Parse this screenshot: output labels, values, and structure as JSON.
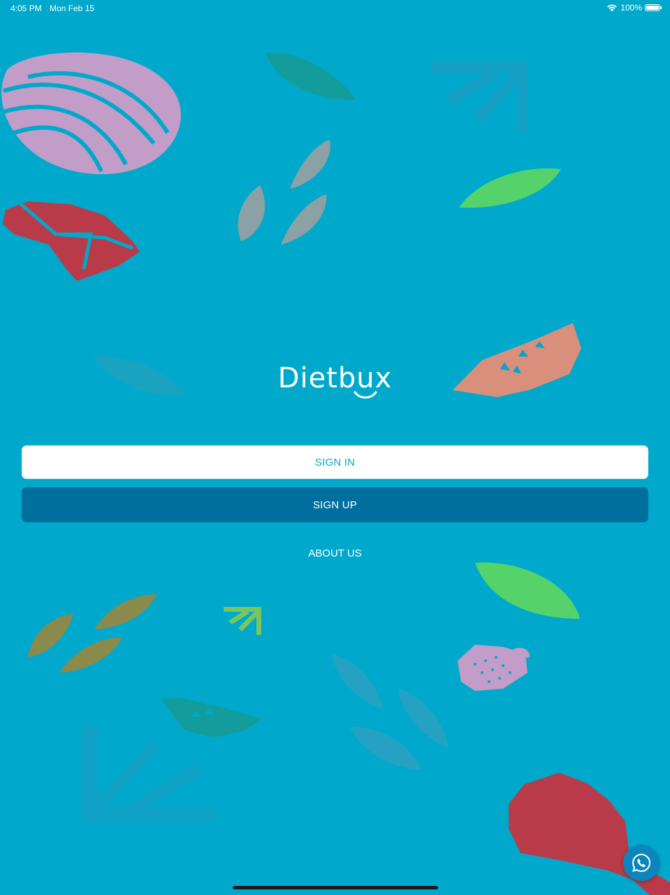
{
  "status_bar": {
    "time": "4:05 PM",
    "date": "Mon Feb 15",
    "battery": "100%",
    "icons": [
      "wifi-icon",
      "battery-icon"
    ]
  },
  "logo": {
    "text": "Dietbux"
  },
  "buttons": {
    "sign_in": "SIGN IN",
    "sign_up": "SIGN UP",
    "about_us": "ABOUT US"
  },
  "floating_action": {
    "icon": "whatsapp-icon"
  },
  "colors": {
    "background": "#00a9cb",
    "primary_button": "#006f9e",
    "secondary_button": "#ffffff",
    "accent_text": "#00a9cb"
  }
}
